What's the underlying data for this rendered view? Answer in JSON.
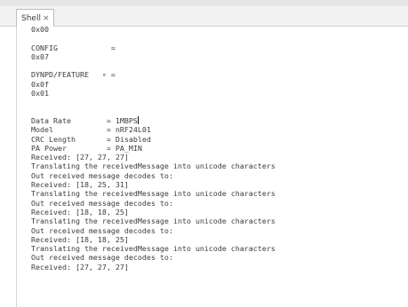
{
  "tab": {
    "label": "Shell",
    "close_glyph": "×"
  },
  "console": {
    "blocks": [
      [
        "0x00"
      ],
      [],
      [
        "CONFIG            ="
      ],
      [
        "0x07"
      ],
      [],
      [
        "DYNPD/FEATURE   ∘ ="
      ],
      [
        "0x0f"
      ],
      [
        "0x01"
      ],
      [],
      [],
      [
        "Data Rate        = 1MBPS"
      ],
      [
        "Model            = nRF24L01"
      ],
      [
        "CRC Length       = Disabled"
      ],
      [
        "PA Power         = PA_MIN"
      ],
      [
        "Received: [27, 27, 27]"
      ],
      [
        "Translating the receivedMessage into unicode characters"
      ],
      [
        "Out received message decodes to:"
      ],
      [
        "Received: [18, 25, 31]"
      ],
      [
        "Translating the receivedMessage into unicode characters"
      ],
      [
        "Out received message decodes to:"
      ],
      [
        "Received: [18, 18, 25]"
      ],
      [
        "Translating the receivedMessage into unicode characters"
      ],
      [
        "Out received message decodes to:"
      ],
      [
        "Received: [18, 18, 25]"
      ],
      [
        "Translating the receivedMessage into unicode characters"
      ],
      [
        "Out received message decodes to:"
      ],
      [
        "Received: [27, 27, 27]"
      ]
    ],
    "lines": [
      "0x00",
      "",
      "CONFIG            =",
      "0x07",
      "",
      "DYNPD/FEATURE   ∘ =",
      "0x0f",
      "0x01",
      "",
      "",
      "Data Rate        = 1MBPS",
      "Model            = nRF24L01",
      "CRC Length       = Disabled",
      "PA Power         = PA_MIN",
      "Received: [27, 27, 27]",
      "Translating the receivedMessage into unicode characters",
      "Out received message decodes to:",
      "Received: [18, 25, 31]",
      "Translating the receivedMessage into unicode characters",
      "Out received message decodes to:",
      "Received: [18, 18, 25]",
      "Translating the receivedMessage into unicode characters",
      "Out received message decodes to:",
      "Received: [18, 18, 25]",
      "Translating the receivedMessage into unicode characters",
      "Out received message decodes to:",
      "Received: [27, 27, 27]"
    ]
  }
}
